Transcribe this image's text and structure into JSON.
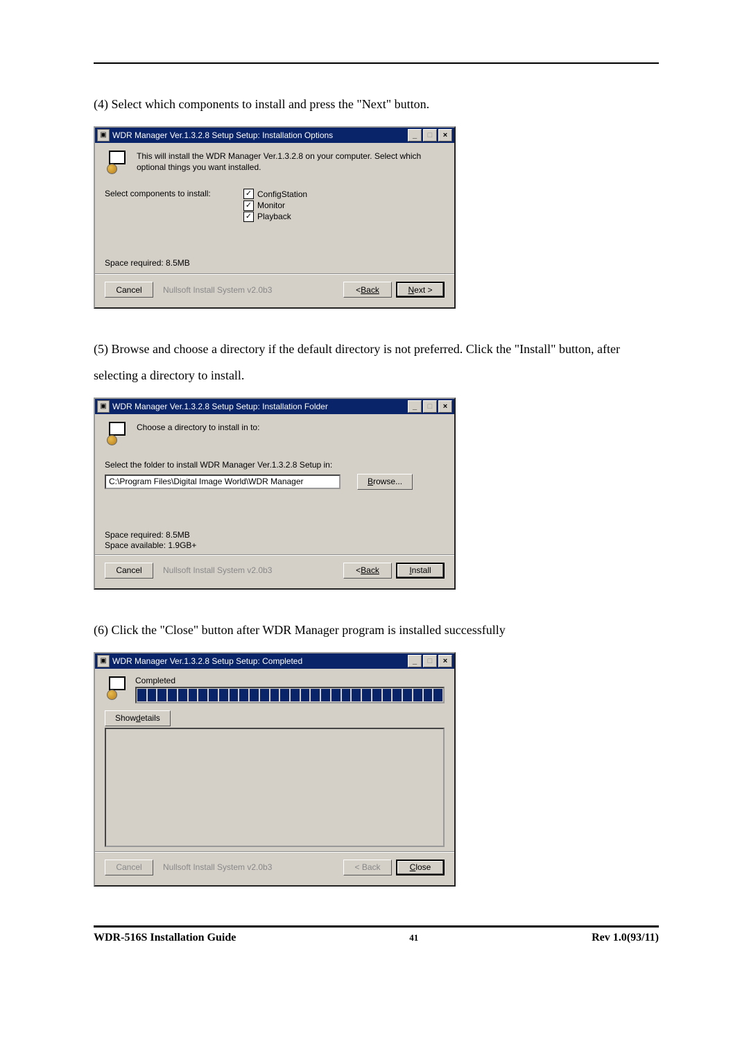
{
  "page": {
    "text4": "(4) Select which components to install and press the \"Next\" button.",
    "text5": "(5) Browse and choose a directory if the default directory is not preferred. Click the \"Install\" button, after selecting a directory to install.",
    "text6": "(6) Click the \"Close\" button after WDR Manager program is installed successfully"
  },
  "dialog1": {
    "title": "WDR Manager Ver.1.3.2.8 Setup Setup: Installation Options",
    "header": "This will install the WDR Manager Ver.1.3.2.8 on your computer. Select which optional things you want installed.",
    "select_label": "Select components to install:",
    "items": [
      "ConfigStation",
      "Monitor",
      "Playback"
    ],
    "space": "Space required: 8.5MB",
    "cancel": "Cancel",
    "nullsoft": "Nullsoft Install System v2.0b3",
    "back": "Back",
    "next": "Next >"
  },
  "dialog2": {
    "title": "WDR Manager Ver.1.3.2.8 Setup Setup: Installation Folder",
    "header": "Choose a directory to install in to:",
    "select_label": "Select the folder to install WDR Manager Ver.1.3.2.8 Setup in:",
    "path": "C:\\Program Files\\Digital Image World\\WDR Manager",
    "browse": "Browse...",
    "space1": "Space required: 8.5MB",
    "space2": "Space available: 1.9GB+",
    "cancel": "Cancel",
    "nullsoft": "Nullsoft Install System v2.0b3",
    "back": "Back",
    "install": "Install"
  },
  "dialog3": {
    "title": "WDR Manager Ver.1.3.2.8 Setup Setup: Completed",
    "completed": "Completed",
    "showdetails": "Show details",
    "cancel": "Cancel",
    "nullsoft": "Nullsoft Install System v2.0b3",
    "back": "< Back",
    "close": "Close"
  },
  "footer": {
    "left": "WDR-516S  Installation  Guide",
    "center": "41",
    "right": "Rev  1.0(93/11)"
  }
}
